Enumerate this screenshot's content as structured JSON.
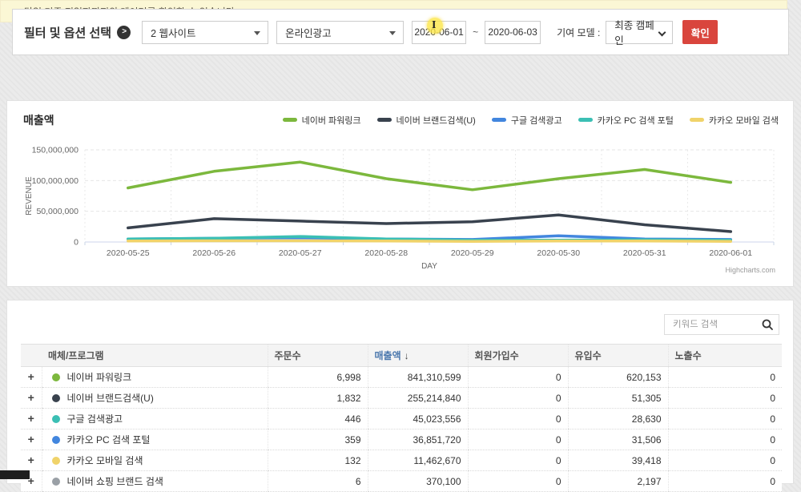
{
  "filter_bar": {
    "title": "필터 및 옵션 선택",
    "website_select": "2 웹사이트",
    "ad_select": "온라인광고",
    "date_from": "2020-06-01",
    "tilde": "~",
    "date_to": "2020-06-03",
    "attribution_label": "기여 모델 :",
    "attribution_select": "최종 캠페인",
    "confirm_button": "확인"
  },
  "notice": {
    "text": "당일 기준 전일자까지의 데이터를 확인할 수 있습니다."
  },
  "chart": {
    "title": "매출액",
    "credit": "Highcharts.com"
  },
  "chart_data": {
    "type": "line",
    "x": [
      "2020-05-25",
      "2020-05-26",
      "2020-05-27",
      "2020-05-28",
      "2020-05-29",
      "2020-05-30",
      "2020-05-31",
      "2020-06-01"
    ],
    "series": [
      {
        "name": "네이버 파워링크",
        "color": "#7cb83d",
        "values": [
          88000000,
          115000000,
          130000000,
          103000000,
          85000000,
          103000000,
          118000000,
          97000000
        ]
      },
      {
        "name": "네이버 브랜드검색(U)",
        "color": "#39424e",
        "values": [
          23000000,
          38000000,
          34000000,
          30000000,
          33000000,
          44000000,
          28000000,
          17000000
        ]
      },
      {
        "name": "구글 검색광고",
        "color": "#4286de",
        "values": [
          5000000,
          6000000,
          7000000,
          5000000,
          4000000,
          10000000,
          5000000,
          4000000
        ]
      },
      {
        "name": "카카오 PC 검색 포털",
        "color": "#3bbfb4",
        "values": [
          5000000,
          6000000,
          9000000,
          5000000,
          3000000,
          3000000,
          3500000,
          3000000
        ]
      },
      {
        "name": "카카오 모바일 검색",
        "color": "#f0d36a",
        "values": [
          1500000,
          2000000,
          2000000,
          1500000,
          1000000,
          1500000,
          1500000,
          1000000
        ]
      }
    ],
    "xlabel": "DAY",
    "ylabel": "REVENUE",
    "ylim": [
      0,
      150000000
    ],
    "yticks": [
      "0",
      "50,000,000",
      "100,000,000",
      "150,000,000"
    ],
    "grid": true,
    "legend_position": "top-right"
  },
  "table": {
    "search_placeholder": "키워드 검색",
    "expand_glyph": "+",
    "sort_arrow": "↓",
    "sort_col_index": 2,
    "columns": [
      "매체/프로그램",
      "주문수",
      "매출액",
      "회원가입수",
      "유입수",
      "노출수"
    ],
    "rows": [
      {
        "name": "네이버 파워링크",
        "color": "#7cb83d",
        "orders": "6,998",
        "revenue": "841,310,599",
        "signups": "0",
        "inflow": "620,153",
        "impressions": "0"
      },
      {
        "name": "네이버 브랜드검색(U)",
        "color": "#39424e",
        "orders": "1,832",
        "revenue": "255,214,840",
        "signups": "0",
        "inflow": "51,305",
        "impressions": "0"
      },
      {
        "name": "구글 검색광고",
        "color": "#3bbfb4",
        "orders": "446",
        "revenue": "45,023,556",
        "signups": "0",
        "inflow": "28,630",
        "impressions": "0"
      },
      {
        "name": "카카오 PC 검색 포털",
        "color": "#4286de",
        "orders": "359",
        "revenue": "36,851,720",
        "signups": "0",
        "inflow": "31,506",
        "impressions": "0"
      },
      {
        "name": "카카오 모바일 검색",
        "color": "#f0d36a",
        "orders": "132",
        "revenue": "11,462,670",
        "signups": "0",
        "inflow": "39,418",
        "impressions": "0"
      },
      {
        "name": "네이버 쇼핑 브랜드 검색",
        "color": "#9aa0a6",
        "orders": "6",
        "revenue": "370,100",
        "signups": "0",
        "inflow": "2,197",
        "impressions": "0"
      }
    ]
  }
}
